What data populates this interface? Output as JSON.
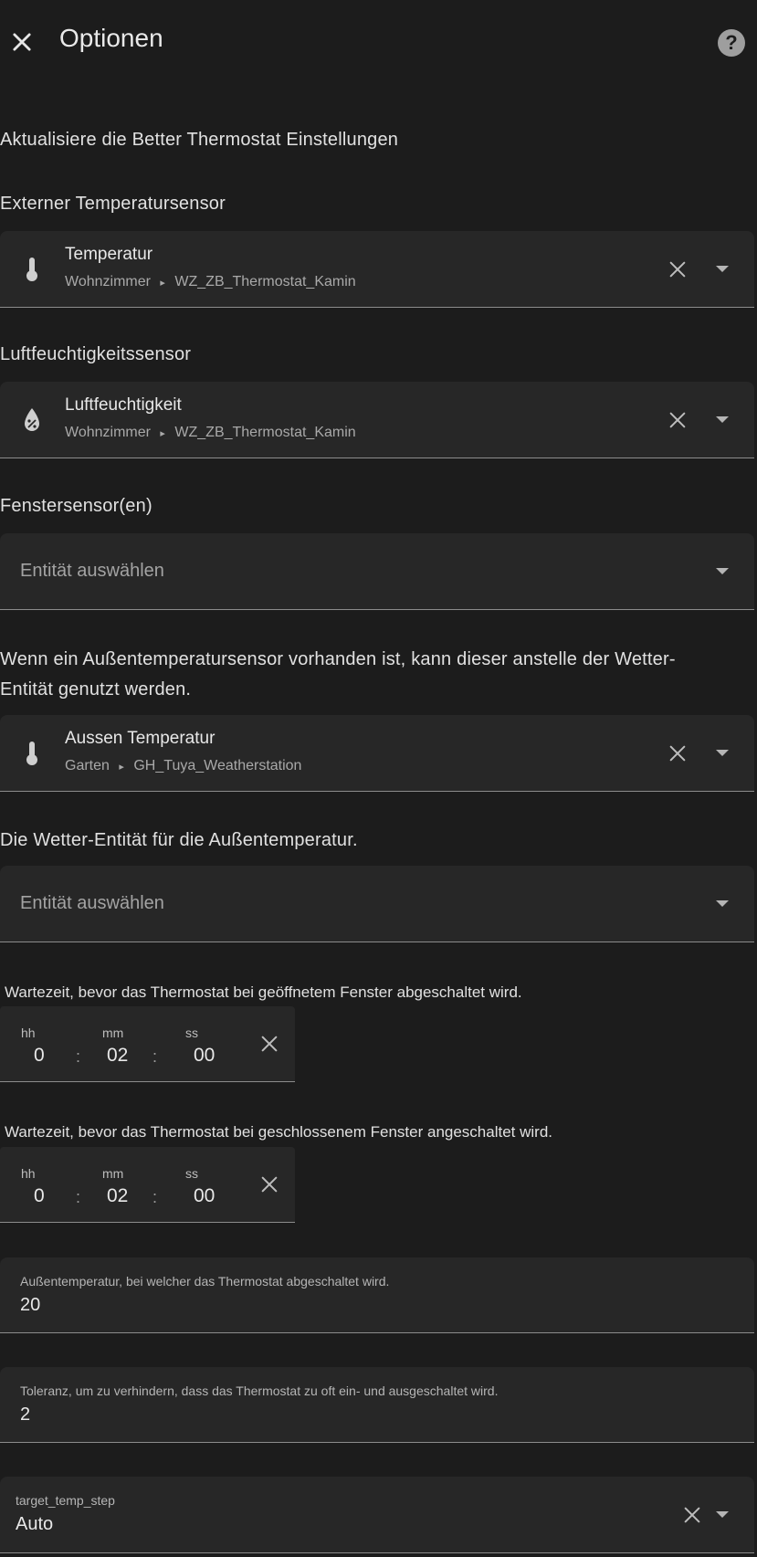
{
  "header": {
    "title": "Optionen"
  },
  "intro": "Aktualisiere die Better Thermostat Einstellungen",
  "temp_sensor": {
    "label": "Externer Temperatursensor",
    "title": "Temperatur",
    "area": "Wohnzimmer",
    "device": "WZ_ZB_Thermostat_Kamin"
  },
  "humidity_sensor": {
    "label": "Luftfeuchtigkeitssensor",
    "title": "Luftfeuchtigkeit",
    "area": "Wohnzimmer",
    "device": "WZ_ZB_Thermostat_Kamin"
  },
  "window_sensor": {
    "label": "Fenstersensor(en)",
    "placeholder": "Entität auswählen"
  },
  "outdoor_sensor": {
    "label_line1": "Wenn ein Außentemperatursensor vorhanden ist, kann dieser anstelle der Wetter-",
    "label_line2": "Entität genutzt werden.",
    "title": "Aussen Temperatur",
    "area": "Garten",
    "device": "GH_Tuya_Weatherstation"
  },
  "weather_entity": {
    "label": "Die Wetter-Entität für die Außentemperatur.",
    "placeholder": "Entität auswählen"
  },
  "window_open_delay": {
    "label": "Wartezeit, bevor das Thermostat bei geöffnetem Fenster abgeschaltet wird.",
    "hh_label": "hh",
    "mm_label": "mm",
    "ss_label": "ss",
    "hh": "0",
    "mm": "02",
    "ss": "00"
  },
  "window_close_delay": {
    "label": "Wartezeit, bevor das Thermostat bei geschlossenem Fenster angeschaltet wird.",
    "hh_label": "hh",
    "mm_label": "mm",
    "ss_label": "ss",
    "hh": "0",
    "mm": "02",
    "ss": "00"
  },
  "off_temperature": {
    "label": "Außentemperatur, bei welcher das Thermostat abgeschaltet wird.",
    "value": "20"
  },
  "tolerance": {
    "label": "Toleranz, um zu verhindern, dass das Thermostat zu oft ein- und ausgeschaltet wird.",
    "value": "2"
  },
  "target_temp_step": {
    "label": "target_temp_step",
    "value": "Auto"
  },
  "separator": ":",
  "breadcrumb_arrow": "▸",
  "icons": {
    "close": "close-icon",
    "help": "help-icon",
    "thermometer": "thermometer-icon",
    "water_percent": "water-percent-icon",
    "clear": "clear-icon",
    "dropdown": "chevron-down-icon"
  },
  "colors": {
    "background": "#1c1c1c",
    "field": "#272727",
    "text": "#e1e1e1",
    "secondary": "#a9a9a9"
  }
}
